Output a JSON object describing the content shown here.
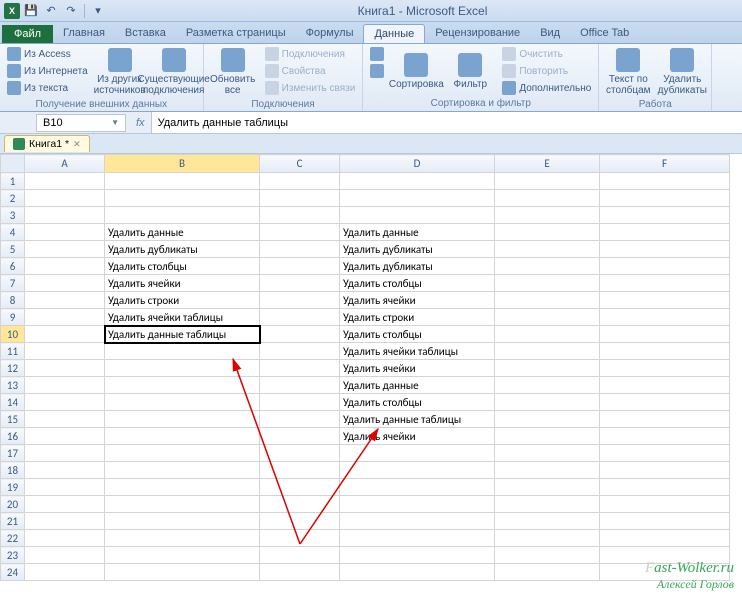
{
  "title": "Книга1 - Microsoft Excel",
  "file_tab": "Файл",
  "tabs": [
    "Главная",
    "Вставка",
    "Разметка страницы",
    "Формулы",
    "Данные",
    "Рецензирование",
    "Вид",
    "Office Tab"
  ],
  "active_tab": 4,
  "ribbon": {
    "groups": [
      {
        "label": "Получение внешних данных",
        "small": [
          "Из Access",
          "Из Интернета",
          "Из текста"
        ],
        "large": [
          "Из других\nисточников",
          "Существующие\nподключения"
        ]
      },
      {
        "label": "Подключения",
        "large": [
          "Обновить\nвсе"
        ],
        "small": [
          "Подключения",
          "Свойства",
          "Изменить связи"
        ]
      },
      {
        "label": "Сортировка и фильтр",
        "large": [
          "Сортировка",
          "Фильтр"
        ],
        "small": [
          "Очистить",
          "Повторить",
          "Дополнительно"
        ],
        "sort_icons": [
          "А↓Я",
          "Я↓А"
        ]
      },
      {
        "label": "Работа",
        "large": [
          "Текст по\nстолбцам",
          "Удалить\nдубликаты"
        ]
      }
    ]
  },
  "namebox": "B10",
  "formula": "Удалить данные таблицы",
  "sheet_tab": "Книга1 *",
  "columns": [
    "A",
    "B",
    "C",
    "D",
    "E",
    "F"
  ],
  "row_count": 24,
  "selected_cell": {
    "row": 10,
    "col": "B"
  },
  "data_b": {
    "4": "Удалить данные",
    "5": "Удалить дубликаты",
    "6": "Удалить столбцы",
    "7": "Удалить ячейки",
    "8": "Удалить строки",
    "9": "Удалить ячейки таблицы",
    "10": "Удалить данные таблицы"
  },
  "data_d": {
    "4": "Удалить данные",
    "5": "Удалить дубликаты",
    "6": "Удалить дубликаты",
    "7": "Удалить столбцы",
    "8": "Удалить ячейки",
    "9": "Удалить строки",
    "10": "Удалить столбцы",
    "11": "Удалить ячейки таблицы",
    "12": "Удалить ячейки",
    "13": "Удалить данные",
    "14": "Удалить столбцы",
    "15": "Удалить данные таблицы",
    "16": "Удалить ячейки"
  },
  "watermark": {
    "line1_a": "F",
    "line1_b": "ast-Wolker.ru",
    "line2": "Алексей Горлов"
  }
}
